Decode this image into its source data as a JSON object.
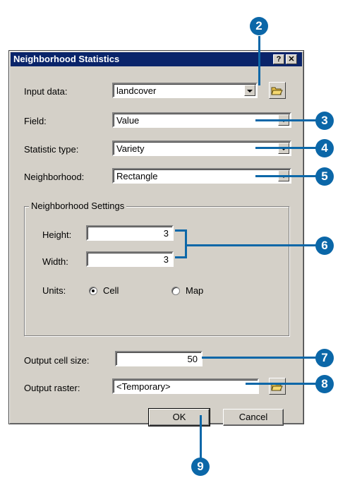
{
  "dialog": {
    "title": "Neighborhood Statistics",
    "help_button": "?",
    "close_button": "✕"
  },
  "fields": {
    "input_data": {
      "label": "Input data:",
      "value": "landcover"
    },
    "field": {
      "label": "Field:",
      "value": "Value"
    },
    "statistic_type": {
      "label": "Statistic type:",
      "value": "Variety"
    },
    "neighborhood": {
      "label": "Neighborhood:",
      "value": "Rectangle"
    }
  },
  "neighborhood_settings": {
    "title": "Neighborhood Settings",
    "height": {
      "label": "Height:",
      "value": "3"
    },
    "width": {
      "label": "Width:",
      "value": "3"
    },
    "units": {
      "label": "Units:",
      "options": [
        "Cell",
        "Map"
      ],
      "selected": "Cell"
    }
  },
  "output": {
    "cell_size": {
      "label": "Output cell size:",
      "value": "50"
    },
    "raster": {
      "label": "Output raster:",
      "value": "<Temporary>"
    }
  },
  "buttons": {
    "ok": "OK",
    "cancel": "Cancel"
  },
  "callouts": [
    "2",
    "3",
    "4",
    "5",
    "6",
    "7",
    "8",
    "9"
  ],
  "colors": {
    "callout": "#0b67a8",
    "titlebar": "#0a246a",
    "dialog": "#d4d0c8"
  }
}
